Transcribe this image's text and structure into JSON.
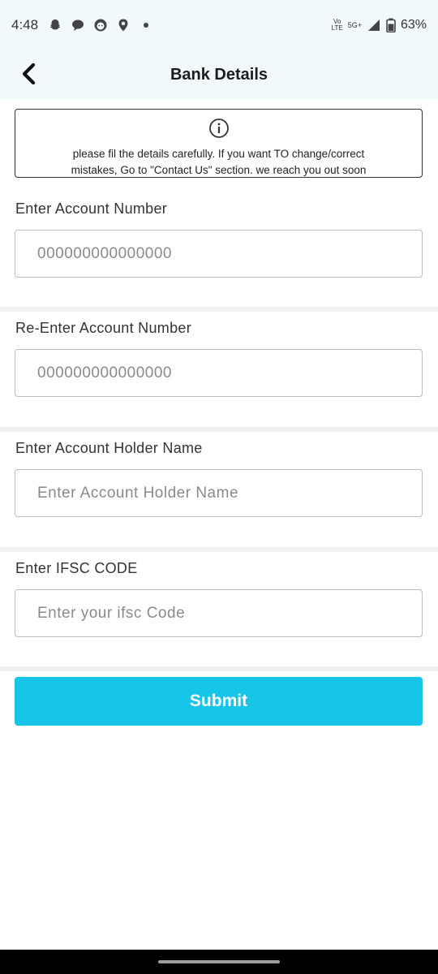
{
  "status_bar": {
    "time": "4:48",
    "network_top": "Vo",
    "network_bottom": "LTE",
    "network_type": "5G+",
    "battery": "63%"
  },
  "header": {
    "title": "Bank Details",
    "back_icon": "chevron-left-icon"
  },
  "info": {
    "icon": "info-icon",
    "line1": "please fil the details carefully. If you want TO change/correct",
    "line2": "mistakes, Go to \"Contact Us\" section. we reach you out soon"
  },
  "form": {
    "account_number": {
      "label": "Enter Account Number",
      "placeholder": "000000000000000",
      "value": ""
    },
    "reenter_account_number": {
      "label": "Re-Enter Account Number",
      "placeholder": "000000000000000",
      "value": ""
    },
    "holder_name": {
      "label": "Enter Account Holder Name",
      "placeholder": "Enter Account Holder Name",
      "value": ""
    },
    "ifsc": {
      "label": "Enter IFSC CODE",
      "placeholder": "Enter your ifsc Code",
      "value": ""
    },
    "submit_label": "Submit"
  },
  "colors": {
    "header_bg": "#f2f9fd",
    "accent": "#17c5e8",
    "divider": "#f1f1f1"
  }
}
